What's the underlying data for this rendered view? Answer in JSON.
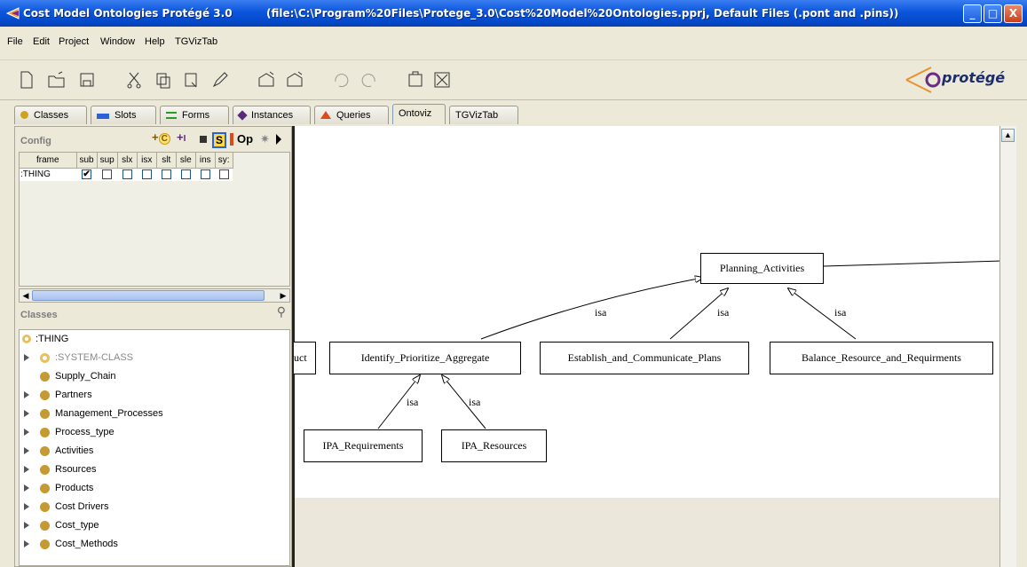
{
  "window": {
    "title": "Cost Model Ontologies Protégé 3.0",
    "path": "(file:\\C:\\Program%20Files\\Protege_3.0\\Cost%20Model%20Ontologies.pprj, Default Files (.pont and .pins))",
    "minimize": "_",
    "maximize": "□",
    "close": "X"
  },
  "menu": [
    "File",
    "Edit",
    "Project",
    "Window",
    "Help",
    "TGVizTab"
  ],
  "logo": "protégé",
  "tabs": [
    "Classes",
    "Slots",
    "Forms",
    "Instances",
    "Queries",
    "Ontoviz",
    "TGVizTab"
  ],
  "active_tab": "Ontoviz",
  "config": {
    "title": "Config",
    "toolbar": [
      "C",
      "I",
      "S",
      "Op"
    ],
    "columns": [
      "frame",
      "sub",
      "sup",
      "slx",
      "isx",
      "slt",
      "sle",
      "ins",
      "sy:"
    ],
    "rows": [
      {
        "frame": ":THING",
        "checks": [
          true,
          false,
          false,
          false,
          false,
          false,
          false,
          false
        ]
      }
    ]
  },
  "classes": {
    "title": "Classes",
    "items": [
      {
        "label": ":THING",
        "expandable": false,
        "selected": true
      },
      {
        "label": ":SYSTEM-CLASS",
        "expandable": true,
        "system": true
      },
      {
        "label": "Supply_Chain",
        "expandable": false
      },
      {
        "label": "Partners",
        "expandable": true
      },
      {
        "label": "Management_Processes",
        "expandable": true
      },
      {
        "label": "Process_type",
        "expandable": true
      },
      {
        "label": "Activities",
        "expandable": true
      },
      {
        "label": "Rsources",
        "expandable": true
      },
      {
        "label": "Products",
        "expandable": true
      },
      {
        "label": "Cost Drivers",
        "expandable": true
      },
      {
        "label": "Cost_type",
        "expandable": true
      },
      {
        "label": "Cost_Methods",
        "expandable": true
      }
    ]
  },
  "graph": {
    "nodes": {
      "planning": "Planning_Activities",
      "cut": "uct",
      "identify": "Identify_Prioritize_Aggregate",
      "establish": "Establish_and_Communicate_Plans",
      "balance": "Balance_Resource_and_Requirments",
      "ipa_req": "IPA_Requirements",
      "ipa_res": "IPA_Resources"
    },
    "edge_label": "isa"
  },
  "colors": {
    "titlebar": "#0a55dc",
    "class_dot": "#c59a32",
    "chrome": "#ece9d8"
  }
}
